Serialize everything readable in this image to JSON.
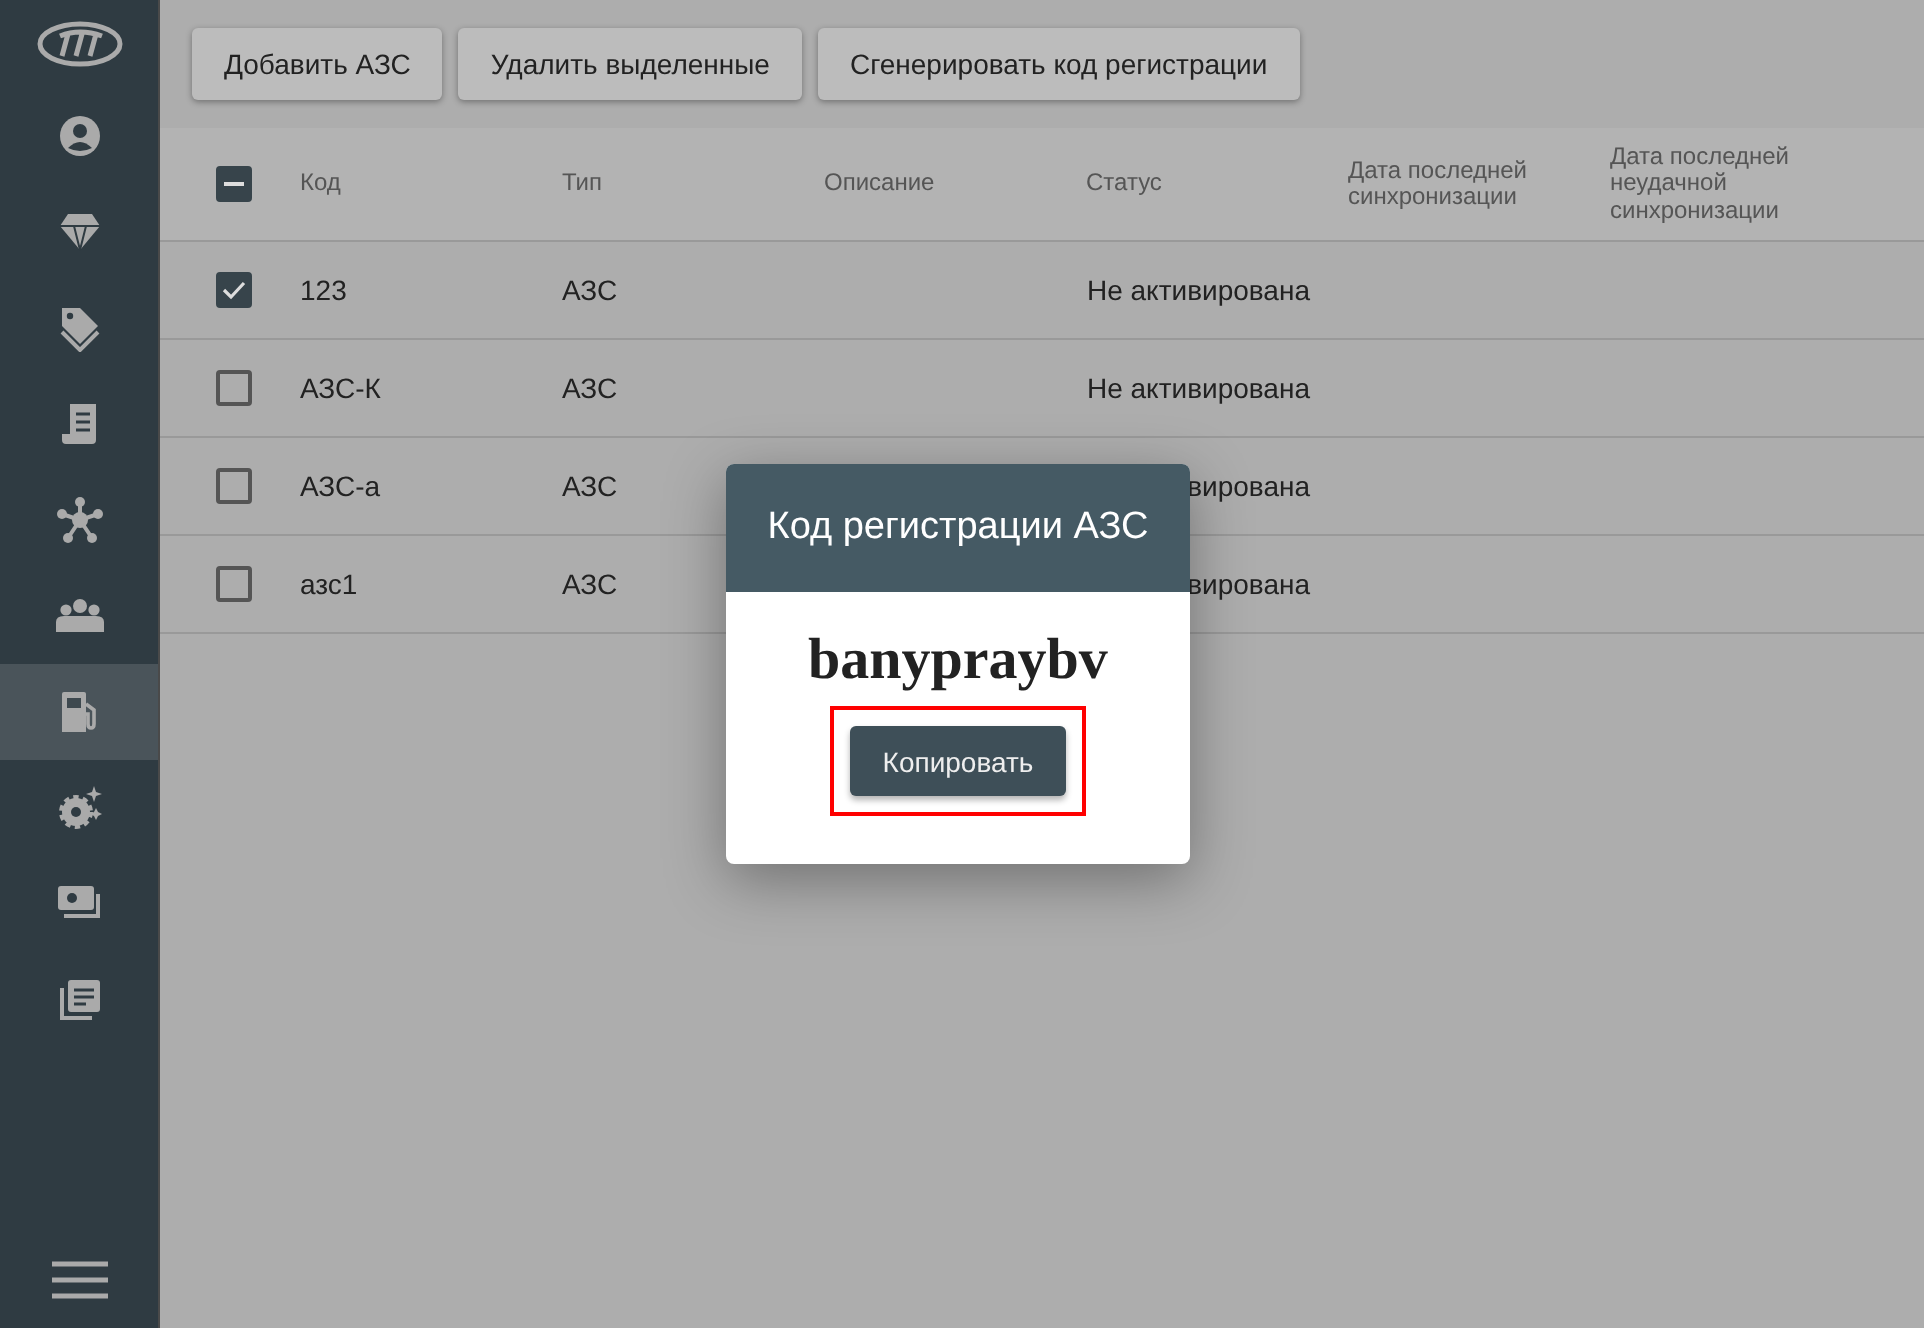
{
  "sidebar": {
    "items": [
      {
        "selected": false
      },
      {
        "selected": false
      },
      {
        "selected": false
      },
      {
        "selected": false
      },
      {
        "selected": false
      },
      {
        "selected": false
      },
      {
        "selected": true
      },
      {
        "selected": false
      },
      {
        "selected": false
      },
      {
        "selected": false
      }
    ]
  },
  "toolbar": {
    "buttons": [
      "Добавить АЗС",
      "Удалить выделенные",
      "Сгенерировать код регистрации"
    ]
  },
  "table": {
    "select_all": {
      "indeterminate": true
    },
    "columns": [
      "Код",
      "Тип",
      "Описание",
      "Статус",
      "Дата последней синхронизации",
      "Дата последней неудачной синхронизации"
    ],
    "rows": [
      {
        "checked": true,
        "code": "123",
        "type": "АЗС",
        "status": "Не активирована"
      },
      {
        "checked": false,
        "code": "АЗС-К",
        "type": "АЗС",
        "status": "Не активирована"
      },
      {
        "checked": false,
        "code": "АЗС-а",
        "type": "АЗС",
        "status": "вирована"
      },
      {
        "checked": false,
        "code": "азс1",
        "type": "АЗС",
        "status": "вирована"
      }
    ]
  },
  "dialog": {
    "title": "Код регистрации АЗС",
    "code": "banypraybv",
    "button": "Копировать",
    "button_highlighted": true
  }
}
